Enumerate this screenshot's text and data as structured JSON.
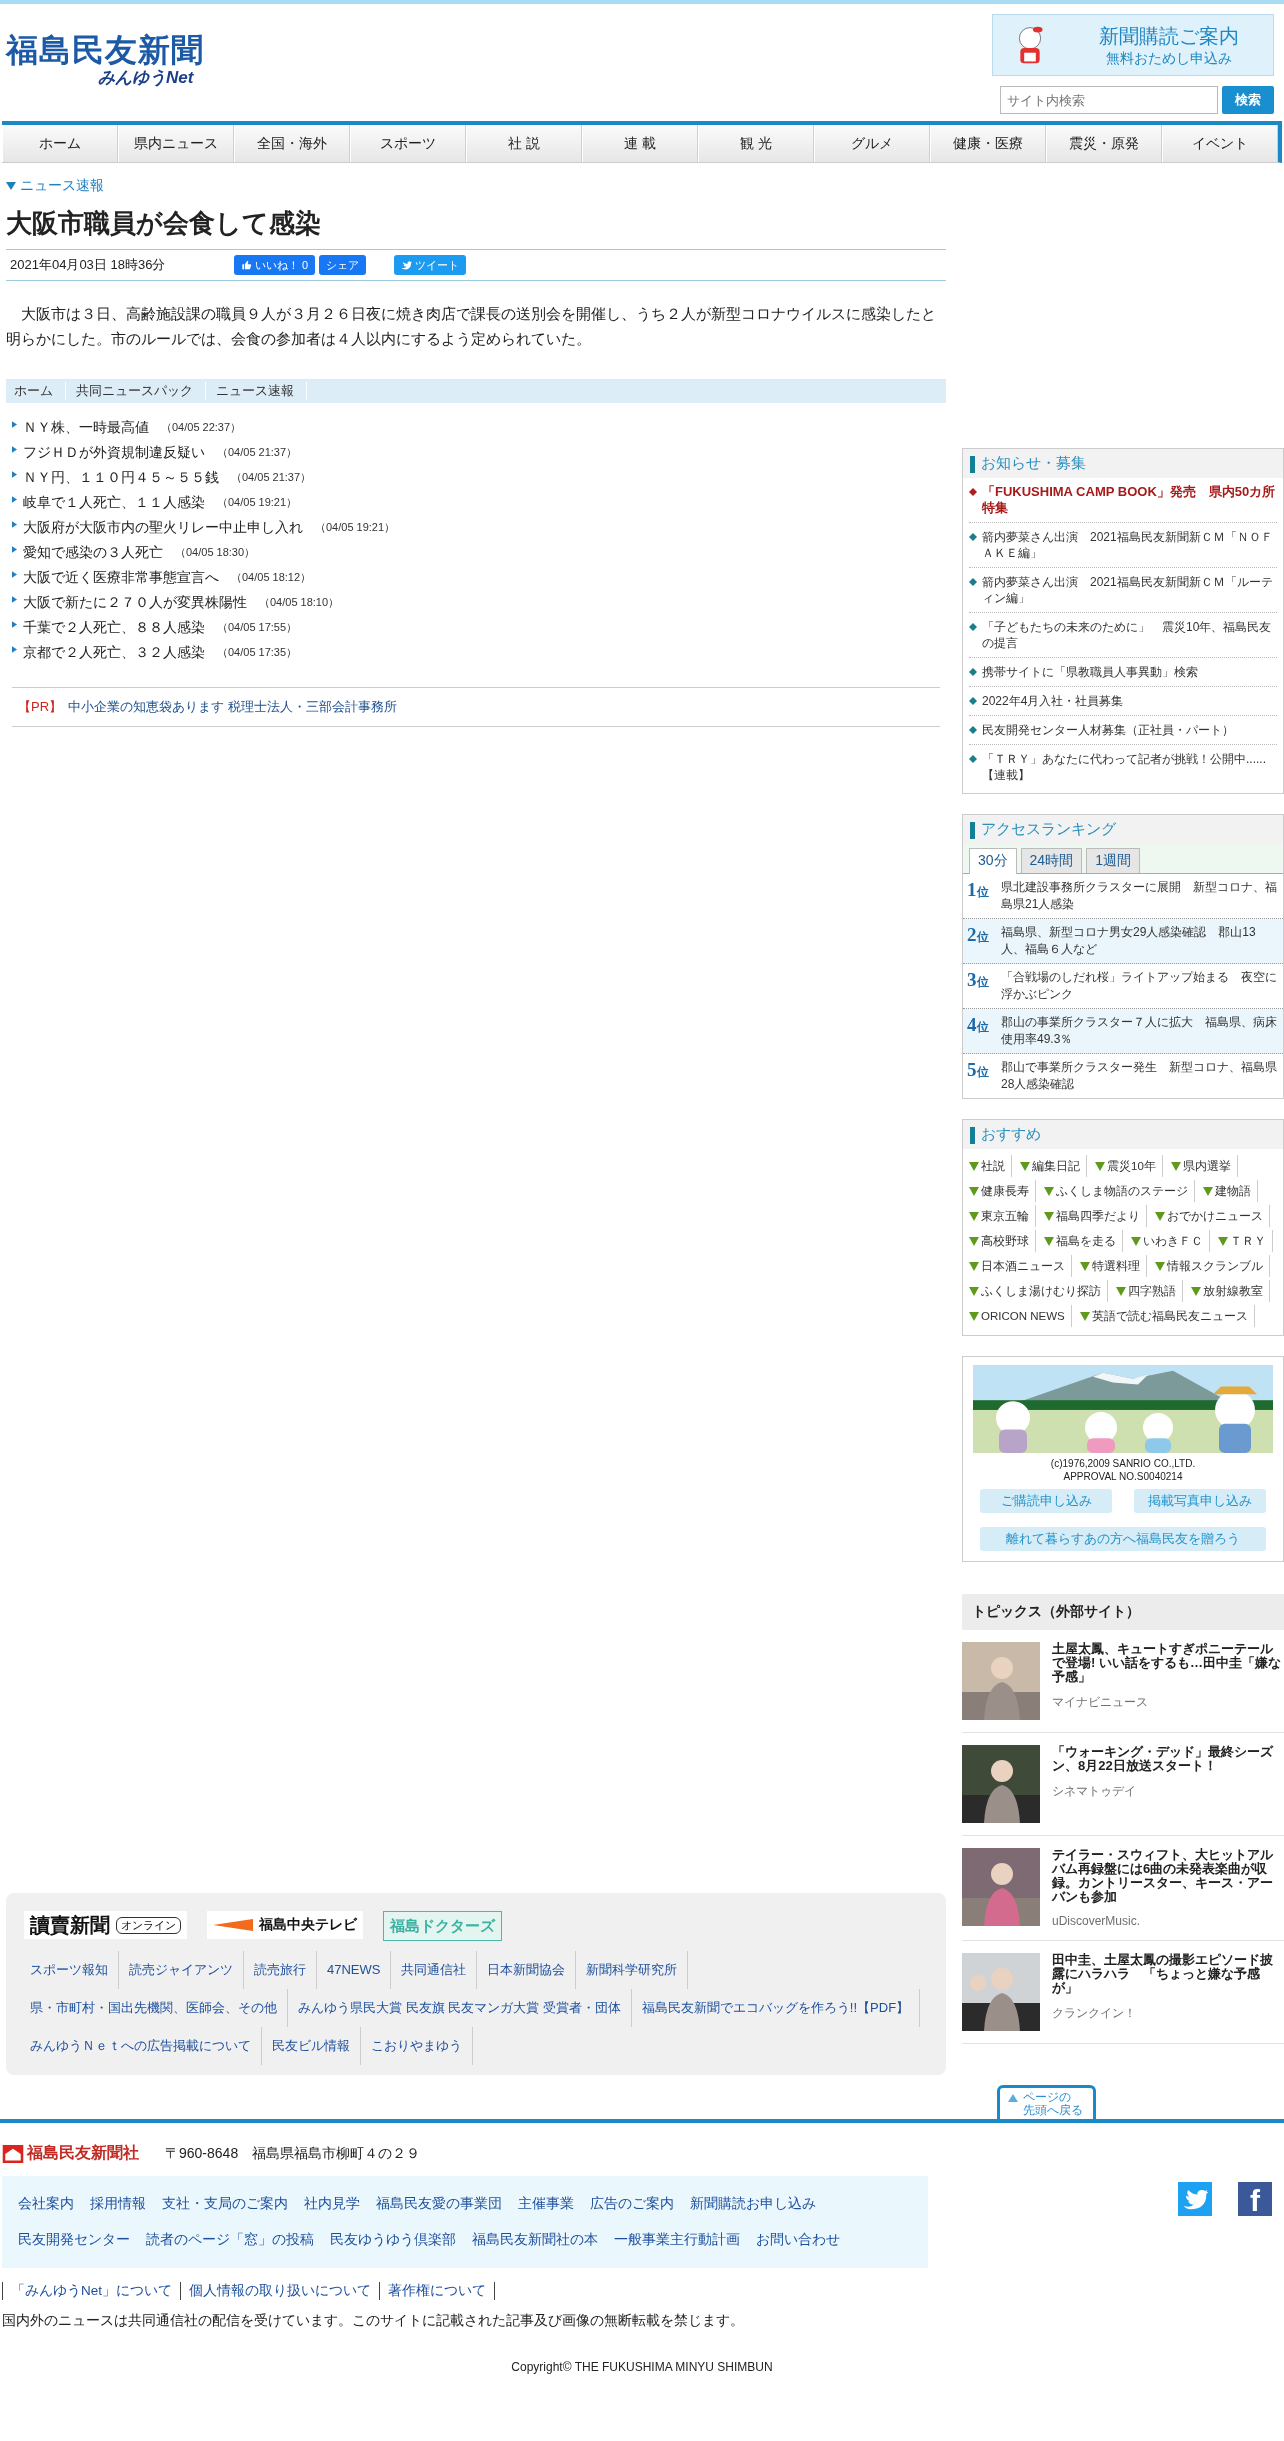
{
  "header": {
    "logo_title": "福島民友新聞",
    "logo_subtitle": "みんゆうNet",
    "banner": {
      "title": "新聞購読ご案内",
      "subtitle": "無料おためし申込み"
    },
    "search": {
      "placeholder": "サイト内検索",
      "button": "検索"
    }
  },
  "nav": [
    "ホーム",
    "県内ニュース",
    "全国・海外",
    "スポーツ",
    "社 説",
    "連 載",
    "観 光",
    "グルメ",
    "健康・医療",
    "震災・原発",
    "イベント"
  ],
  "article": {
    "section": "ニュース速報",
    "title": "大阪市職員が会食して感染",
    "date": "2021年04月03日 18時36分",
    "like": "いいね！ 0",
    "share": "シェア",
    "tweet": "ツイート",
    "body": "　大阪市は３日、高齢施設課の職員９人が３月２６日夜に焼き肉店で課長の送別会を開催し、うち２人が新型コロナウイルスに感染したと明らかにした。市のルールでは、会食の参加者は４人以内にするよう定められていた。"
  },
  "breadcrumb": [
    "ホーム",
    "共同ニュースパック",
    "ニュース速報"
  ],
  "news": [
    {
      "title": "ＮＹ株、一時最高値",
      "time": "（04/05 22:37）"
    },
    {
      "title": "フジＨＤが外資規制違反疑い",
      "time": "（04/05 21:37）"
    },
    {
      "title": "ＮＹ円、１１０円４５～５５銭",
      "time": "（04/05 21:37）"
    },
    {
      "title": "岐阜で１人死亡、１１人感染",
      "time": "（04/05 19:21）"
    },
    {
      "title": "大阪府が大阪市内の聖火リレー中止申し入れ",
      "time": "（04/05 19:21）"
    },
    {
      "title": "愛知で感染の３人死亡",
      "time": "（04/05 18:30）"
    },
    {
      "title": "大阪で近く医療非常事態宣言へ",
      "time": "（04/05 18:12）"
    },
    {
      "title": "大阪で新たに２７０人が変異株陽性",
      "time": "（04/05 18:10）"
    },
    {
      "title": "千葉で２人死亡、８８人感染",
      "time": "（04/05 17:55）"
    },
    {
      "title": "京都で２人死亡、３２人感染",
      "time": "（04/05 17:35）"
    }
  ],
  "pr": {
    "label": "【PR】",
    "text": "中小企業の知恵袋あります 税理士法人・三部会計事務所"
  },
  "partners": {
    "logos": [
      {
        "text": "讀賣新聞",
        "badge": "オンライン",
        "kind": "yomiuri"
      },
      {
        "text": "福島中央テレビ",
        "kind": "tv"
      },
      {
        "text": "福島ドクターズ",
        "kind": "doctors"
      }
    ],
    "lines": [
      {
        "links": [
          "スポーツ報知",
          "読売ジャイアンツ",
          "読売旅行",
          "47NEWS",
          "共同通信社",
          "日本新聞協会",
          "新聞科学研究所"
        ]
      },
      {
        "links": [
          "県・市町村・国出先機関、医師会、その他",
          "みんゆう県民大賞 民友旗 民友マンガ大賞 受賞者・団体",
          "福島民友新聞でエコバッグを作ろう!!【PDF】"
        ]
      },
      {
        "links": [
          "みんゆうＮｅｔへの広告掲載について",
          "民友ビル情報",
          "こおりやまゆう"
        ]
      }
    ]
  },
  "sidebar": {
    "notices": {
      "title": "お知らせ・募集",
      "items": [
        {
          "text": "「FUKUSHIMA CAMP BOOK」発売　県内50カ所特集",
          "highlight": true
        },
        {
          "text": "箭内夢菜さん出演　2021福島民友新聞新ＣＭ「ＮＯＦＡＫＥ編」",
          "highlight": false
        },
        {
          "text": "箭内夢菜さん出演　2021福島民友新聞新ＣＭ「ルーティン編」",
          "highlight": false
        },
        {
          "text": "「子どもたちの未来のために」　震災10年、福島民友の提言",
          "highlight": false
        },
        {
          "text": "携帯サイトに「県教職員人事異動」検索",
          "highlight": false
        },
        {
          "text": "2022年4月入社・社員募集",
          "highlight": false
        },
        {
          "text": "民友開発センター人材募集（正社員・パート）",
          "highlight": false
        },
        {
          "text": "「ＴＲＹ」あなたに代わって記者が挑戦！公開中......【連載】",
          "highlight": false
        }
      ]
    },
    "ranking": {
      "title": "アクセスランキング",
      "tabs": [
        {
          "label": "30分",
          "selected": true
        },
        {
          "label": "24時間",
          "selected": false
        },
        {
          "label": "1週間",
          "selected": false
        }
      ],
      "items": [
        {
          "rank": "1",
          "unit": "位",
          "text": "県北建設事務所クラスターに展開　新型コロナ、福島県21人感染"
        },
        {
          "rank": "2",
          "unit": "位",
          "text": "福島県、新型コロナ男女29人感染確認　郡山13人、福島６人など"
        },
        {
          "rank": "3",
          "unit": "位",
          "text": "「合戦場のしだれ桜」ライトアップ始まる　夜空に浮かぶピンク"
        },
        {
          "rank": "4",
          "unit": "位",
          "text": "郡山の事業所クラスター７人に拡大　福島県、病床使用率49.3％"
        },
        {
          "rank": "5",
          "unit": "位",
          "text": "郡山で事業所クラスター発生　新型コロナ、福島県28人感染確認"
        }
      ]
    },
    "recommend": {
      "title": "おすすめ",
      "items": [
        "社説",
        "編集日記",
        "震災10年",
        "県内選挙",
        "健康長寿",
        "ふくしま物語のステージ",
        "建物語",
        "東京五輪",
        "福島四季だより",
        "おでかけニュース",
        "高校野球",
        "福島を走る",
        "いわきＦＣ",
        "ＴＲＹ",
        "日本酒ニュース",
        "特選料理",
        "情報スクランブル",
        "ふくしま湯けむり探訪",
        "四字熟語",
        "放射線教室",
        "ORICON NEWS",
        "英語で読む福島民友ニュース"
      ]
    },
    "promo": {
      "caption": [
        "(c)1976,2009 SANRIO CO.,LTD.",
        "APPROVAL NO.S0040214"
      ],
      "buttons": [
        "ご購読申し込み",
        "掲載写真申し込み",
        "離れて暮らすあの方へ福島民友を贈ろう"
      ]
    },
    "topics": {
      "title": "トピックス（外部サイト）",
      "items": [
        {
          "title": "土屋太鳳、キュートすぎポニーテールで登場! いい話をするも…田中圭「嫌な予感」",
          "source": "マイナビニュース"
        },
        {
          "title": "「ウォーキング・デッド」最終シーズン、8月22日放送スタート！",
          "source": "シネマトゥデイ"
        },
        {
          "title": "テイラー・スウィフト、大ヒットアルバム再録盤には6曲の未発表楽曲が収録。カントリースター、キース・アーバンも参加",
          "source": "uDiscoverMusic."
        },
        {
          "title": "田中圭、土屋太鳳の撮影エピソード披露にハラハラ　「ちょっと嫌な予感が」",
          "source": "クランクイン！"
        }
      ]
    }
  },
  "page_top": [
    "ページの",
    "先頭へ戻る"
  ],
  "footer": {
    "logo": "福島民友新聞社",
    "address": "〒960-8648　福島県福島市柳町４の２９",
    "links": [
      [
        "会社案内",
        "採用情報",
        "支社・支局のご案内",
        "社内見学",
        "福島民友愛の事業団",
        "主催事業",
        "広告のご案内",
        "新聞購読お申し込み"
      ],
      [
        "民友開発センター",
        "読者のページ「窓」の投稿",
        "民友ゆうゆう倶楽部",
        "福島民友新聞社の本",
        "一般事業主行動計画",
        "お問い合わせ"
      ]
    ],
    "sub_links": [
      "「みんゆうNet」について",
      "個人情報の取り扱いについて",
      "著作権について"
    ],
    "notice": "国内外のニュースは共同通信社の配信を受けています。このサイトに記載された記事及び画像の無断転載を禁じます。",
    "facebook": "f",
    "copyright": "Copyright© THE FUKUSHIMA MINYU SHIMBUN"
  }
}
